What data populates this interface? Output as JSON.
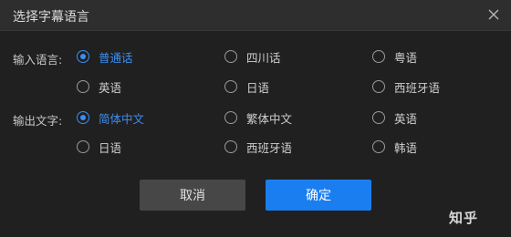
{
  "dialog": {
    "title": "选择字幕语言",
    "close_icon": "close-icon"
  },
  "input_language": {
    "label": "输入语言:",
    "options": [
      {
        "label": "普通话",
        "checked": true
      },
      {
        "label": "四川话",
        "checked": false
      },
      {
        "label": "粤语",
        "checked": false
      },
      {
        "label": "英语",
        "checked": false
      },
      {
        "label": "日语",
        "checked": false
      },
      {
        "label": "西班牙语",
        "checked": false
      }
    ]
  },
  "output_text": {
    "label": "输出文字:",
    "options": [
      {
        "label": "简体中文",
        "checked": true
      },
      {
        "label": "繁体中文",
        "checked": false
      },
      {
        "label": "英语",
        "checked": false
      },
      {
        "label": "日语",
        "checked": false
      },
      {
        "label": "西班牙语",
        "checked": false
      },
      {
        "label": "韩语",
        "checked": false
      }
    ]
  },
  "buttons": {
    "cancel": "取消",
    "confirm": "确定"
  },
  "watermark": "知乎",
  "colors": {
    "accent": "#3b8ff2",
    "confirm_bg": "#1a7ef0",
    "cancel_bg": "#474747",
    "background": "#202020",
    "titlebar_bg": "#2e2e2e"
  }
}
